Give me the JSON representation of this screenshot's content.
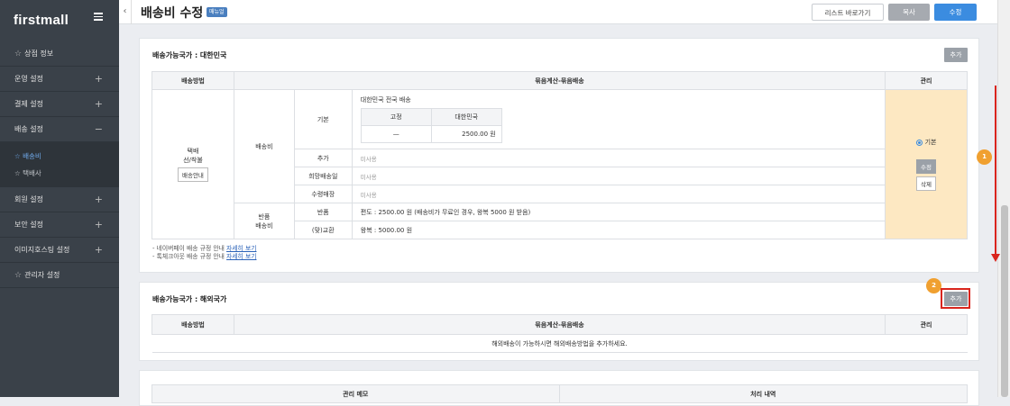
{
  "sidebar": {
    "logo": "firstmall",
    "items": [
      {
        "label": "상점 정보",
        "star": true
      },
      {
        "label": "운영 설정",
        "expand": "+"
      },
      {
        "label": "결제 설정",
        "expand": "+"
      },
      {
        "label": "배송 설정",
        "expand": "−"
      },
      {
        "label": "회원 설정",
        "expand": "+"
      },
      {
        "label": "보안 설정",
        "expand": "+"
      },
      {
        "label": "이미지호스팅 설정",
        "expand": "+"
      },
      {
        "label": "관리자 설정",
        "star": true
      }
    ],
    "subitems": [
      {
        "label": "배송비",
        "active": true
      },
      {
        "label": "택배사",
        "active": false
      }
    ]
  },
  "header": {
    "back_icon": "‹",
    "title": "배송비 수정",
    "tag": "매뉴얼",
    "list_button": "리스트 바로가기",
    "copy_button": "복사",
    "edit_button": "수정"
  },
  "domestic": {
    "title": "배송가능국가 : 대한민국",
    "add_button": "추가",
    "headers": [
      "배송방법",
      "묶음계산-묶음배송",
      "관리"
    ],
    "method_lines": [
      "택배",
      "선/착불"
    ],
    "guide_button": "배송안내",
    "group_fee": "배송비",
    "group_return_1": "반품",
    "group_return_2": "배송비",
    "rows": {
      "basic_label": "기본",
      "basic_desc": "대한민국 전국 배송",
      "inner_headers": [
        "고정",
        "대한민국"
      ],
      "inner_values": [
        "—",
        "2500.00 원"
      ],
      "add_label": "추가",
      "add_value": "미사용",
      "hope_label": "희망배송일",
      "hope_value": "미사용",
      "store_label": "수령매장",
      "store_value": "미사용",
      "return_label": "반품",
      "return_value": "편도 : 2500.00 원 (배송비가 무료인 경우, 왕복 5000 원 받음)",
      "exchange_label": "(맞)교환",
      "exchange_value": "왕복 : 5000.00 원"
    },
    "mgmt_default": "기본",
    "mgmt_edit": "수정",
    "mgmt_delete": "삭제",
    "notes": [
      {
        "text": "- 네이버페이 배송 규정 안내 ",
        "link": "자세히 보기"
      },
      {
        "text": "- 톡체크아웃 배송 규정 안내 ",
        "link": "자세히 보기"
      }
    ]
  },
  "overseas": {
    "title": "배송가능국가 : 해외국가",
    "add_button": "추가",
    "headers": [
      "배송방법",
      "묶음계산-묶음배송",
      "관리"
    ],
    "empty_message": "해외배송이 가능하시면 해외배송방법을 추가하세요."
  },
  "memo": {
    "headers": [
      "관리 메모",
      "처리 내역"
    ]
  },
  "annotations": {
    "badge1": "1",
    "badge2": "2",
    "accent": "#d9251d",
    "badge_color": "#f0a030"
  }
}
